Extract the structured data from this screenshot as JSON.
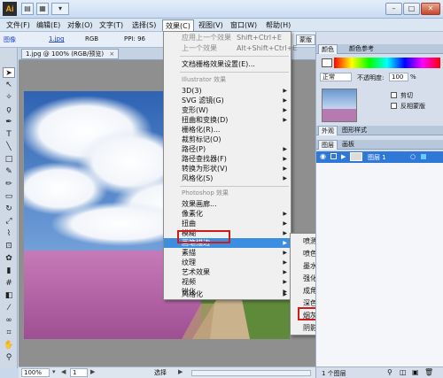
{
  "titlebar": {
    "logo": "Ai",
    "window_controls": {
      "min": "–",
      "max": "□",
      "close": "✕"
    }
  },
  "menubar": {
    "items": [
      "文件(F)",
      "编辑(E)",
      "对象(O)",
      "文字(T)",
      "选择(S)",
      "效果(C)",
      "视图(V)",
      "窗口(W)",
      "帮助(H)"
    ],
    "active": "效果(C)"
  },
  "control_bar": {
    "type_label": "图像",
    "filename": "1.jpg",
    "color_mode": "RGB",
    "ppi": "PPI: 96",
    "right_button": "蒙版"
  },
  "document": {
    "tab_title": "1.jpg @ 100% (RGB/预览)",
    "close": "×"
  },
  "status_bar": {
    "zoom": "100%",
    "page": "1",
    "tool": "选择"
  },
  "effects_menu": {
    "top": [
      {
        "label": "应用上一个效果",
        "shortcut": "Shift+Ctrl+E",
        "disabled": true
      },
      {
        "label": "上一个效果",
        "shortcut": "Alt+Shift+Ctrl+E",
        "disabled": true
      }
    ],
    "doc_raster": "文档栅格效果设置(E)...",
    "illustrator_header": "Illustrator 效果",
    "illustrator_items": [
      "3D(3)",
      "SVG 滤镜(G)",
      "变形(W)",
      "扭曲和变换(D)",
      "栅格化(R)...",
      "裁剪标记(O)",
      "路径(P)",
      "路径查找器(F)",
      "转换为形状(V)",
      "风格化(S)"
    ],
    "photoshop_header": "Photoshop 效果",
    "photoshop_items": [
      "效果画廊...",
      "像素化",
      "扭曲",
      "模糊",
      "画笔描边",
      "素描",
      "纹理",
      "艺术效果",
      "视频",
      "锐化",
      "风格化"
    ],
    "highlighted": "画笔描边"
  },
  "brush_submenu": {
    "items": [
      "喷溅...",
      "喷色描边...",
      "墨水轮廓...",
      "强化的边缘...",
      "成角的线条...",
      "深色线条...",
      "烟灰墨...",
      "阴影线..."
    ],
    "boxed": "烟灰墨..."
  },
  "color_panel": {
    "tabs": [
      "颜色",
      "颜色参考"
    ]
  },
  "transparency": {
    "mode": "正常",
    "opacity_label": "不透明度:",
    "opacity": "100",
    "unit": "%",
    "clip": "剪切",
    "invert": "反相蒙版"
  },
  "appearance_tabs": [
    "外观",
    "图形样式"
  ],
  "layers_panel": {
    "tabs": [
      "图层",
      "画板"
    ],
    "layer_num": "1",
    "layer_name": "图层 1",
    "footer": "1 个图层"
  },
  "colors": {
    "menu_highlight": "#3c8fe0",
    "callout_red": "#d11b1b",
    "layer_color": "#2f78d8"
  }
}
